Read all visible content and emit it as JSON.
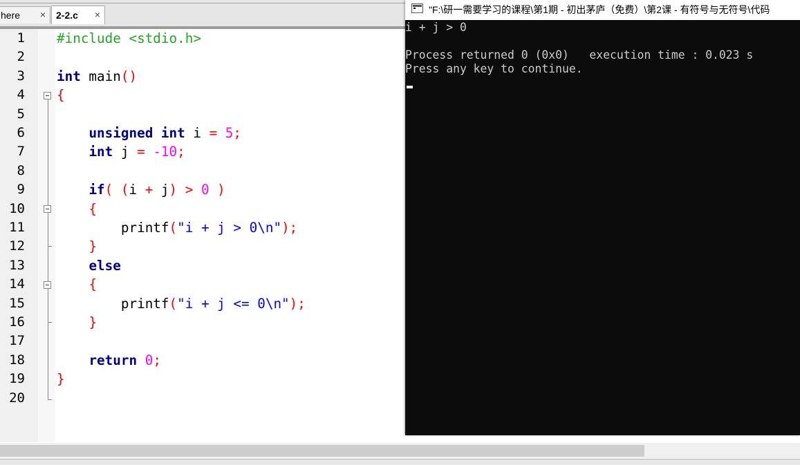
{
  "editor": {
    "tabs": [
      {
        "label": "here",
        "close": "×"
      },
      {
        "label": "2-2.c",
        "close": "×",
        "active": true
      }
    ],
    "line_numbers": [
      "1",
      "2",
      "3",
      "4",
      "5",
      "6",
      "7",
      "8",
      "9",
      "10",
      "11",
      "12",
      "13",
      "14",
      "15",
      "16",
      "17",
      "18",
      "19",
      "20"
    ],
    "code": {
      "l1_pp": "#include <stdio.h>",
      "l3_kw": "int",
      "l3_rest": " main",
      "l3_paren": "()",
      "l4_brace": "{",
      "l6_kw1": "unsigned",
      "l6_kw2": "int",
      "l6_var": " i ",
      "l6_eq": "=",
      "l6_num": "5",
      "l6_semi": ";",
      "l7_kw": "int",
      "l7_var": " j ",
      "l7_eq": "=",
      "l7_num": "-10",
      "l7_semi": ";",
      "l9_kw": "if",
      "l9_p1": "( (",
      "l9_i": "i ",
      "l9_plus": "+",
      "l9_j": " j",
      "l9_p2": ") > ",
      "l9_zero": "0",
      "l9_p3": " )",
      "l10_brace": "{",
      "l11_fn": "printf",
      "l11_p": "(",
      "l11_str": "\"i + j > 0\\n\"",
      "l11_end": ");",
      "l12_brace": "}",
      "l13_kw": "else",
      "l14_brace": "{",
      "l15_fn": "printf",
      "l15_p": "(",
      "l15_str": "\"i + j <= 0\\n\"",
      "l15_end": ");",
      "l16_brace": "}",
      "l18_kw": "return",
      "l18_num": " 0",
      "l18_semi": ";",
      "l19_brace": "}"
    }
  },
  "console": {
    "title": "\"F:\\研一需要学习的课程\\第1期 - 初出茅庐（免费）\\第2课 - 有符号与无符号\\代码",
    "output_line1": "i + j > 0",
    "output_line2": "Process returned 0 (0x0)   execution time : 0.023 s",
    "output_line3": "Press any key to continue."
  },
  "colors": {
    "keyword": "#00008b",
    "preprocessor": "#22a722",
    "operator": "#ff0000",
    "number": "#ff00ff",
    "string": "#0000ff",
    "console_bg": "#0c0c0c",
    "console_text": "#cccccc"
  },
  "icons": [
    "tab-close-icon",
    "console-app-icon",
    "fold-minus-icon"
  ]
}
